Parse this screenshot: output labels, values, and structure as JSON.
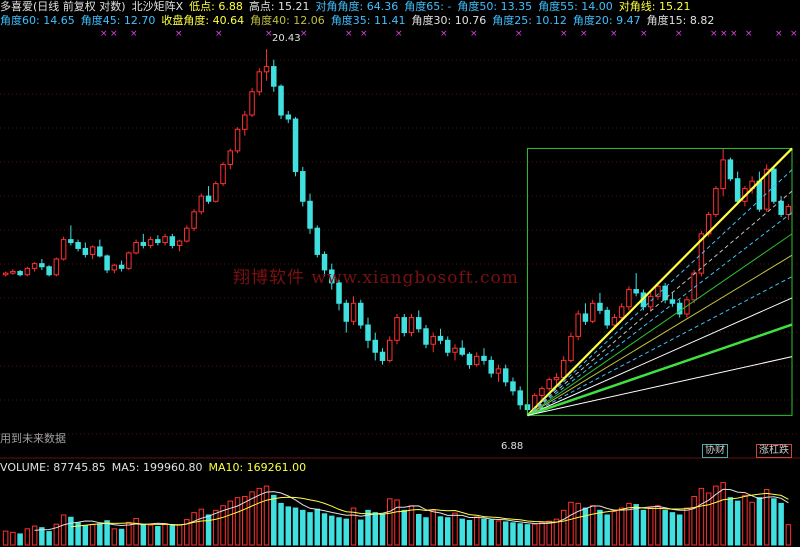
{
  "header": {
    "row1": [
      {
        "t": "多喜爱(日线 前复权 对数)",
        "c": "#e0e0e0"
      },
      {
        "t": "北沙矩阵X",
        "c": "#e0e0e0"
      },
      {
        "t": "低点: 6.88",
        "c": "#ffff40"
      },
      {
        "t": "高点: 15.21",
        "c": "#e0e0e0"
      },
      {
        "t": "对角角度: 64.36",
        "c": "#40c0ff"
      },
      {
        "t": "角度65: -",
        "c": "#40c0ff"
      },
      {
        "t": "角度50: 13.35",
        "c": "#40c0ff"
      },
      {
        "t": "角度55: 14.00",
        "c": "#40c0ff"
      },
      {
        "t": "对角线: 15.21",
        "c": "#ffff40"
      }
    ],
    "row2": [
      {
        "t": "角度60: 14.65",
        "c": "#40c0ff"
      },
      {
        "t": "角度45: 12.70",
        "c": "#40c0ff"
      },
      {
        "t": "收盘角度: 40.64",
        "c": "#ffff40"
      },
      {
        "t": "角度40: 12.06",
        "c": "#c0c040"
      },
      {
        "t": "角度35: 11.41",
        "c": "#40c0ff"
      },
      {
        "t": "角度30: 10.76",
        "c": "#e0e0e0"
      },
      {
        "t": "角度25: 10.12",
        "c": "#40c0ff"
      },
      {
        "t": "角度20: 9.47",
        "c": "#40c0ff"
      },
      {
        "t": "角度15: 8.82",
        "c": "#e0e0e0"
      }
    ]
  },
  "watermark": "翔博软件 www.xiangbosoft.com",
  "side_note": "用到未来数据",
  "annotations": {
    "high_label": "20.43",
    "low_label": "6.88"
  },
  "badges": {
    "left": "协财",
    "right": "涨杠跌"
  },
  "volume_header": [
    {
      "t": "VOLUME: 87745.85",
      "c": "#e0e0e0"
    },
    {
      "t": "MA5: 199960.80",
      "c": "#e0e0e0"
    },
    {
      "t": "MA10: 169261.00",
      "c": "#ffff40"
    }
  ],
  "chart_data": [
    {
      "type": "candlestick",
      "log_scale": true,
      "ylim": [
        6.3,
        21.5
      ],
      "grid": true,
      "up_color": "#ff3030",
      "down_color": "#40e0e0",
      "candles": [
        [
          10.45,
          10.55,
          10.4,
          10.5
        ],
        [
          10.5,
          10.62,
          10.45,
          10.55
        ],
        [
          10.55,
          10.6,
          10.4,
          10.45
        ],
        [
          10.45,
          10.7,
          10.4,
          10.65
        ],
        [
          10.65,
          10.85,
          10.55,
          10.8
        ],
        [
          10.8,
          10.95,
          10.6,
          10.7
        ],
        [
          10.7,
          10.75,
          10.4,
          10.45
        ],
        [
          10.45,
          11.0,
          10.4,
          10.95
        ],
        [
          10.95,
          11.7,
          10.9,
          11.6
        ],
        [
          11.6,
          12.1,
          11.4,
          11.5
        ],
        [
          11.5,
          11.6,
          11.2,
          11.3
        ],
        [
          11.3,
          11.5,
          11.0,
          11.1
        ],
        [
          11.1,
          11.4,
          10.95,
          11.35
        ],
        [
          11.35,
          11.6,
          11.0,
          11.05
        ],
        [
          11.05,
          11.1,
          10.5,
          10.6
        ],
        [
          10.6,
          10.8,
          10.5,
          10.75
        ],
        [
          10.75,
          10.9,
          10.55,
          10.65
        ],
        [
          10.65,
          11.2,
          10.6,
          11.15
        ],
        [
          11.15,
          11.6,
          11.1,
          11.5
        ],
        [
          11.5,
          11.8,
          11.3,
          11.4
        ],
        [
          11.4,
          11.7,
          11.3,
          11.6
        ],
        [
          11.6,
          11.75,
          11.4,
          11.5
        ],
        [
          11.5,
          11.8,
          11.4,
          11.7
        ],
        [
          11.7,
          11.8,
          11.3,
          11.4
        ],
        [
          11.4,
          11.6,
          11.2,
          11.55
        ],
        [
          11.55,
          12.1,
          11.5,
          12.0
        ],
        [
          12.0,
          12.7,
          11.9,
          12.6
        ],
        [
          12.6,
          13.3,
          12.5,
          13.2
        ],
        [
          13.2,
          13.6,
          12.9,
          13.0
        ],
        [
          13.0,
          13.8,
          12.95,
          13.7
        ],
        [
          13.7,
          14.6,
          13.6,
          14.5
        ],
        [
          14.5,
          15.2,
          14.3,
          15.1
        ],
        [
          15.1,
          16.2,
          15.0,
          16.1
        ],
        [
          16.1,
          17.0,
          15.8,
          16.8
        ],
        [
          16.8,
          18.2,
          16.7,
          18.0
        ],
        [
          18.0,
          19.3,
          17.8,
          19.1
        ],
        [
          19.1,
          20.43,
          18.6,
          19.4
        ],
        [
          19.4,
          19.8,
          18.0,
          18.3
        ],
        [
          18.3,
          18.4,
          16.6,
          16.8
        ],
        [
          16.8,
          17.0,
          16.4,
          16.6
        ],
        [
          16.6,
          16.7,
          14.0,
          14.2
        ],
        [
          14.2,
          14.4,
          12.8,
          13.0
        ],
        [
          13.0,
          13.3,
          11.8,
          12.0
        ],
        [
          12.0,
          12.1,
          11.0,
          11.1
        ],
        [
          11.1,
          11.2,
          10.4,
          10.6
        ],
        [
          10.6,
          10.8,
          10.0,
          10.2
        ],
        [
          10.2,
          10.3,
          9.4,
          9.6
        ],
        [
          9.6,
          9.7,
          8.8,
          9.1
        ],
        [
          9.1,
          9.8,
          9.0,
          9.6
        ],
        [
          9.6,
          9.7,
          8.9,
          9.0
        ],
        [
          9.0,
          9.2,
          8.4,
          8.6
        ],
        [
          8.6,
          8.8,
          8.1,
          8.3
        ],
        [
          8.3,
          8.4,
          8.0,
          8.1
        ],
        [
          8.1,
          8.7,
          8.05,
          8.6
        ],
        [
          8.6,
          9.3,
          8.5,
          9.2
        ],
        [
          9.2,
          9.3,
          8.7,
          8.8
        ],
        [
          8.8,
          9.3,
          8.7,
          9.2
        ],
        [
          9.2,
          9.4,
          8.8,
          8.9
        ],
        [
          8.9,
          9.0,
          8.4,
          8.5
        ],
        [
          8.5,
          8.8,
          8.3,
          8.7
        ],
        [
          8.7,
          8.9,
          8.5,
          8.6
        ],
        [
          8.6,
          8.7,
          8.2,
          8.3
        ],
        [
          8.3,
          8.5,
          8.1,
          8.4
        ],
        [
          8.4,
          8.6,
          8.2,
          8.25
        ],
        [
          8.25,
          8.3,
          7.9,
          8.0
        ],
        [
          8.0,
          8.3,
          7.95,
          8.2
        ],
        [
          8.2,
          8.4,
          8.0,
          8.1
        ],
        [
          8.1,
          8.2,
          7.7,
          7.8
        ],
        [
          7.8,
          8.0,
          7.6,
          7.9
        ],
        [
          7.9,
          8.0,
          7.5,
          7.6
        ],
        [
          7.6,
          7.7,
          7.3,
          7.4
        ],
        [
          7.4,
          7.5,
          7.0,
          7.1
        ],
        [
          7.1,
          7.2,
          6.88,
          7.0
        ],
        [
          7.0,
          7.35,
          6.95,
          7.3
        ],
        [
          7.3,
          7.5,
          7.2,
          7.45
        ],
        [
          7.45,
          7.7,
          7.4,
          7.65
        ],
        [
          7.65,
          7.8,
          7.5,
          7.7
        ],
        [
          7.7,
          8.2,
          7.65,
          8.1
        ],
        [
          8.1,
          8.8,
          8.05,
          8.7
        ],
        [
          8.7,
          9.4,
          8.6,
          9.3
        ],
        [
          9.3,
          9.6,
          9.0,
          9.1
        ],
        [
          9.1,
          9.7,
          9.05,
          9.6
        ],
        [
          9.6,
          9.9,
          9.3,
          9.4
        ],
        [
          9.4,
          9.5,
          8.9,
          9.0
        ],
        [
          9.0,
          9.3,
          8.9,
          9.2
        ],
        [
          9.2,
          9.6,
          9.1,
          9.5
        ],
        [
          9.5,
          10.1,
          9.4,
          10.0
        ],
        [
          10.0,
          10.5,
          9.8,
          9.9
        ],
        [
          9.9,
          10.0,
          9.4,
          9.5
        ],
        [
          9.5,
          9.9,
          9.4,
          9.8
        ],
        [
          9.8,
          10.2,
          9.7,
          10.1
        ],
        [
          10.1,
          10.2,
          9.6,
          9.7
        ],
        [
          9.7,
          9.9,
          9.5,
          9.6
        ],
        [
          9.6,
          9.7,
          9.2,
          9.3
        ],
        [
          9.3,
          9.8,
          9.2,
          9.7
        ],
        [
          9.7,
          10.6,
          9.6,
          10.5
        ],
        [
          10.5,
          11.9,
          10.4,
          11.8
        ],
        [
          11.8,
          12.6,
          11.7,
          12.5
        ],
        [
          12.5,
          13.6,
          12.4,
          13.5
        ],
        [
          13.5,
          15.21,
          13.2,
          14.7
        ],
        [
          14.7,
          14.8,
          13.8,
          13.9
        ],
        [
          13.9,
          14.2,
          12.9,
          13.0
        ],
        [
          13.0,
          13.6,
          12.8,
          13.5
        ],
        [
          13.5,
          14.0,
          13.3,
          13.8
        ],
        [
          13.8,
          14.2,
          12.6,
          12.7
        ],
        [
          12.7,
          14.5,
          12.6,
          14.3
        ],
        [
          14.3,
          14.4,
          12.9,
          13.0
        ],
        [
          13.0,
          13.2,
          12.4,
          12.5
        ],
        [
          12.5,
          12.9,
          12.3,
          12.8
        ]
      ],
      "volume": {
        "ylim": [
          0,
          290000
        ],
        "values": [
          60000,
          55000,
          48000,
          70000,
          82000,
          75000,
          58000,
          90000,
          130000,
          120000,
          95000,
          85000,
          88000,
          92000,
          105000,
          70000,
          68000,
          98000,
          115000,
          90000,
          86000,
          80000,
          92000,
          84000,
          88000,
          110000,
          140000,
          155000,
          130000,
          150000,
          170000,
          190000,
          205000,
          210000,
          230000,
          245000,
          255000,
          215000,
          180000,
          165000,
          160000,
          150000,
          140000,
          155000,
          135000,
          125000,
          118000,
          112000,
          160000,
          108000,
          150000,
          140000,
          130000,
          200000,
          195000,
          150000,
          170000,
          132000,
          118000,
          150000,
          122000,
          118000,
          138000,
          112000,
          106000,
          122000,
          112000,
          108000,
          104000,
          100000,
          96000,
          92000,
          88000,
          90000,
          98000,
          103000,
          112000,
          150000,
          185000,
          180000,
          160000,
          170000,
          150000,
          130000,
          145000,
          160000,
          180000,
          175000,
          150000,
          160000,
          170000,
          150000,
          140000,
          130000,
          160000,
          210000,
          245000,
          225000,
          255000,
          270000,
          205000,
          190000,
          215000,
          185000,
          205000,
          240000,
          200000,
          180000,
          87745.85
        ],
        "ma5_label": "MA5",
        "ma10_label": "MA10"
      }
    }
  ]
}
